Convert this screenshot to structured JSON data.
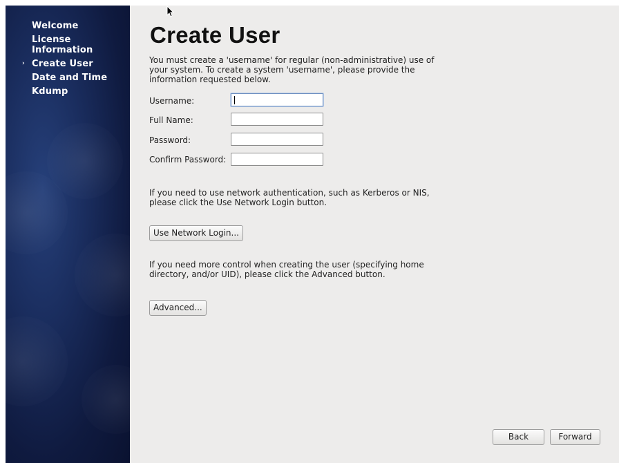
{
  "sidebar": {
    "items": [
      {
        "label": "Welcome",
        "active": false
      },
      {
        "label": "License Information",
        "active": false
      },
      {
        "label": "Create User",
        "active": true
      },
      {
        "label": "Date and Time",
        "active": false
      },
      {
        "label": "Kdump",
        "active": false
      }
    ],
    "active_marker": "›"
  },
  "main": {
    "title": "Create User",
    "intro": "You must create a 'username' for regular (non-administrative) use of your system.  To create a system 'username', please provide the information requested below.",
    "form": {
      "username_label": "Username:",
      "fullname_label": "Full Name:",
      "password_label": "Password:",
      "confirm_label": "Confirm Password:",
      "username_value": "",
      "fullname_value": "",
      "password_value": "",
      "confirm_value": ""
    },
    "network_text": "If you need to use network authentication, such as Kerberos or NIS, please click the Use Network Login button.",
    "network_button": "Use Network Login...",
    "advanced_text": "If you need more control when creating the user (specifying home directory, and/or UID), please click the Advanced button.",
    "advanced_button": "Advanced..."
  },
  "footer": {
    "back_button": "Back",
    "forward_button": "Forward"
  },
  "colors": {
    "sidebar_bg": "#1a2d5e",
    "main_bg": "#edeceb"
  }
}
